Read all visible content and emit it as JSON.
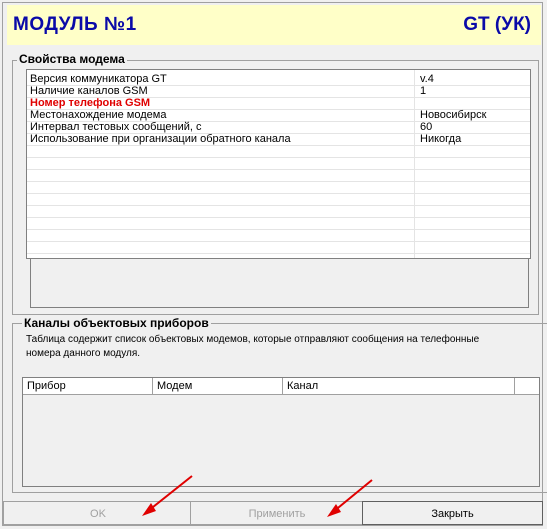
{
  "header": {
    "title": "МОДУЛЬ №1",
    "code": "GT (УК)"
  },
  "modem_properties": {
    "legend": "Свойства модема",
    "rows": [
      {
        "name": "Версия коммуникатора GT",
        "value": "v.4",
        "highlight": false
      },
      {
        "name": "Наличие каналов GSM",
        "value": "1",
        "highlight": false
      },
      {
        "name": "Номер телефона GSM",
        "value": "",
        "highlight": true
      },
      {
        "name": "Местонахождение модема",
        "value": "Новосибирск",
        "highlight": false
      },
      {
        "name": "Интервал тестовых сообщений, с",
        "value": "60",
        "highlight": false
      },
      {
        "name": "Использование при организации обратного канала",
        "value": "Никогда",
        "highlight": false
      }
    ]
  },
  "channels": {
    "legend": "Каналы объектовых приборов",
    "description": "Таблица содержит список объектовых модемов, которые отправляют сообщения на телефонные номера данного модуля.",
    "columns": [
      "Прибор",
      "Модем",
      "Канал",
      ""
    ]
  },
  "buttons": {
    "ok": "OK",
    "apply": "Применить",
    "close": "Закрыть"
  },
  "colors": {
    "header_bg": "#ffffc8",
    "header_text": "#0a0aa8",
    "highlight_text": "#e00000",
    "arrow": "#e00000"
  }
}
